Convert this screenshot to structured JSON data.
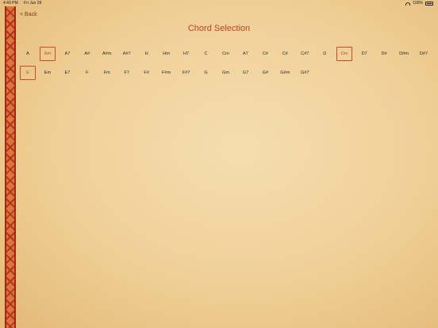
{
  "status": {
    "time": "4:49 PM",
    "date": "Fri Jun 28",
    "battery": "100%"
  },
  "nav": {
    "back_label": "< Back"
  },
  "page": {
    "title": "Chord Selection"
  },
  "chords": {
    "row1": [
      "A",
      "Am",
      "A7",
      "A#",
      "A#m",
      "A#7",
      "H",
      "Hm",
      "H7",
      "C",
      "Cm",
      "A7",
      "C#",
      "C#",
      "C#7",
      "D",
      "Dm",
      "D7",
      "D#",
      "D#m",
      "D#7"
    ],
    "row2": [
      "E",
      "Em",
      "E7",
      "F",
      "Fm",
      "F7",
      "F#",
      "F#m",
      "F#7",
      "G",
      "Gm",
      "G7",
      "G#",
      "G#m",
      "G#7"
    ],
    "selected": [
      "Am",
      "Dm",
      "E"
    ]
  },
  "colors": {
    "accent": "#d0482a",
    "title": "#c3461c"
  }
}
